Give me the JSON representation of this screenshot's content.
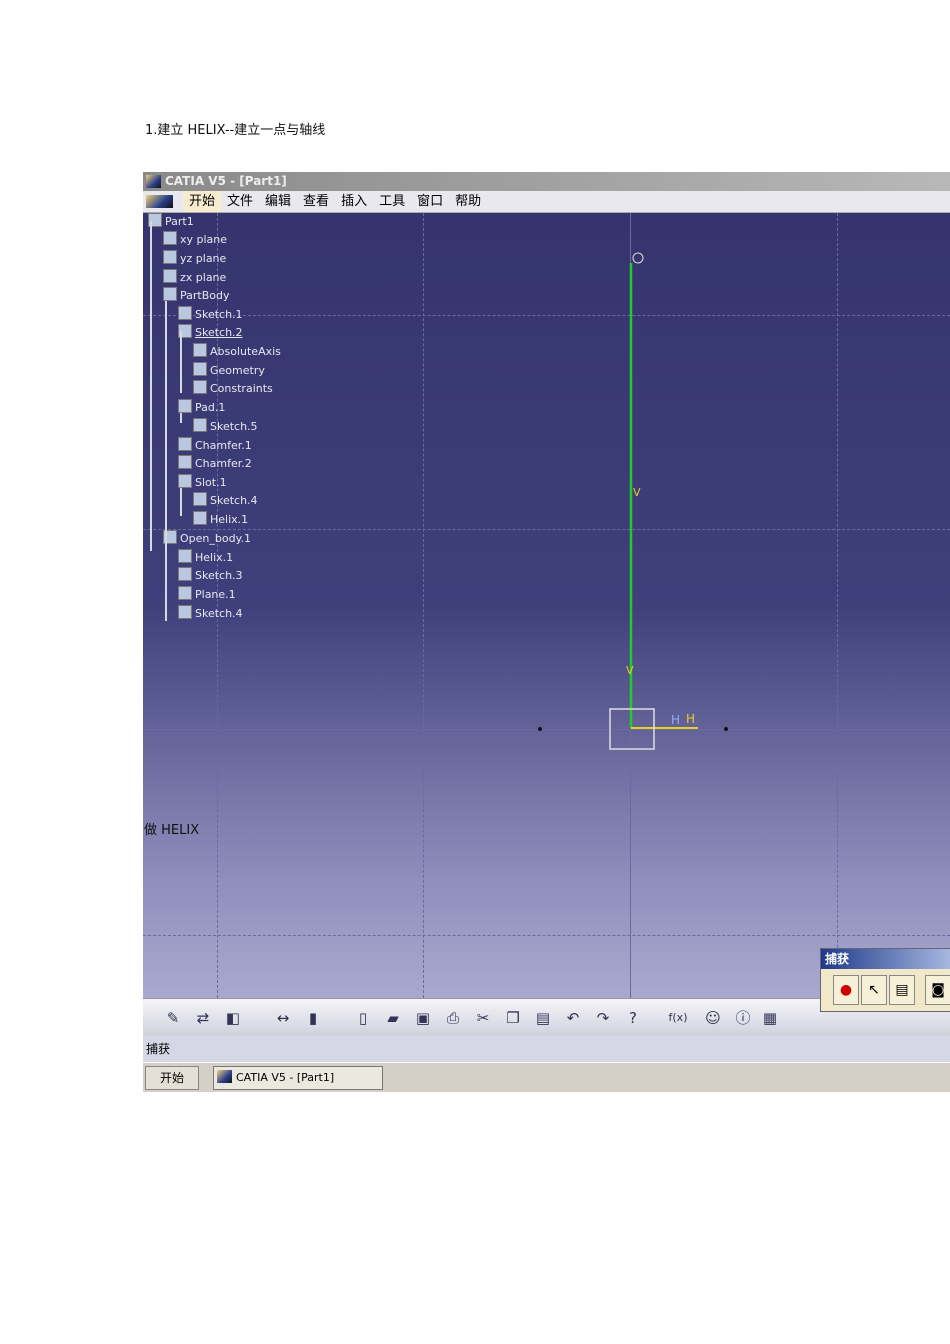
{
  "heading": "1.建立 HELIX--建立一点与轴线",
  "window": {
    "title": "CATIA V5 - [Part1]"
  },
  "menu": [
    "开始",
    "文件",
    "编辑",
    "查看",
    "插入",
    "工具",
    "窗口",
    "帮助"
  ],
  "tree": [
    {
      "label": "Part1",
      "level": 0
    },
    {
      "label": "xy plane",
      "level": 1
    },
    {
      "label": "yz plane",
      "level": 1
    },
    {
      "label": "zx plane",
      "level": 1
    },
    {
      "label": "PartBody",
      "level": 1
    },
    {
      "label": "Sketch.1",
      "level": 2
    },
    {
      "label": "Sketch.2",
      "level": 2,
      "underlined": true
    },
    {
      "label": "AbsoluteAxis",
      "level": 3
    },
    {
      "label": "Geometry",
      "level": 3
    },
    {
      "label": "Constraints",
      "level": 3
    },
    {
      "label": "Pad.1",
      "level": 2
    },
    {
      "label": "Sketch.5",
      "level": 3
    },
    {
      "label": "Chamfer.1",
      "level": 2
    },
    {
      "label": "Chamfer.2",
      "level": 2
    },
    {
      "label": "Slot.1",
      "level": 2
    },
    {
      "label": "Sketch.4",
      "level": 3
    },
    {
      "label": "Helix.1",
      "level": 3
    },
    {
      "label": "Open_body.1",
      "level": 1
    },
    {
      "label": "Helix.1",
      "level": 2
    },
    {
      "label": "Sketch.3",
      "level": 2
    },
    {
      "label": "Plane.1",
      "level": 2
    },
    {
      "label": "Sketch.4",
      "level": 2
    }
  ],
  "viewport": {
    "axis_labels": {
      "v": "V",
      "h": "H"
    },
    "axis_color": "#22cc22",
    "h_axis_color": "#e8d020",
    "caption": "做 HELIX"
  },
  "toolbar": {
    "icons": [
      "sketcher-icon",
      "constraint-icon",
      "traffic-light-icon",
      "measure-icon",
      "inertia-icon",
      "new-icon",
      "open-icon",
      "save-icon",
      "print-icon",
      "cut-icon",
      "copy-icon",
      "paste-icon",
      "undo-icon",
      "redo-icon",
      "whats-this-icon",
      "formula-icon",
      "comment-icon",
      "knowledge-icon",
      "table-icon"
    ]
  },
  "capture": {
    "title": "捕获",
    "buttons": [
      "record-icon",
      "select-icon",
      "album-icon",
      "camera-icon"
    ]
  },
  "status": "捕获",
  "taskbar": {
    "start": "开始",
    "task": "CATIA V5 - [Part1]"
  }
}
